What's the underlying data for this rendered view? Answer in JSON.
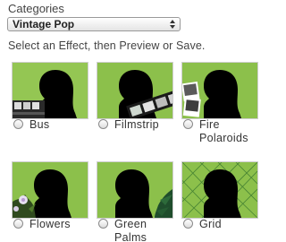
{
  "categories": {
    "label": "Categories",
    "selected": "Vintage Pop"
  },
  "instruction": "Select an Effect, then Preview or Save.",
  "effects": [
    {
      "label": "Bus",
      "icon": "silhouette-bus-thumbnail"
    },
    {
      "label": "Filmstrip",
      "icon": "silhouette-filmstrip-thumbnail"
    },
    {
      "label": "Fire\nPolaroids",
      "icon": "silhouette-fire-polaroids-thumbnail"
    },
    {
      "label": "Flowers",
      "icon": "silhouette-flowers-thumbnail"
    },
    {
      "label": "Green\nPalms",
      "icon": "silhouette-green-palms-thumbnail"
    },
    {
      "label": "Grid",
      "icon": "silhouette-grid-thumbnail"
    }
  ],
  "colors": {
    "thumb_green": "#8cc04b",
    "silhouette": "#000000"
  }
}
